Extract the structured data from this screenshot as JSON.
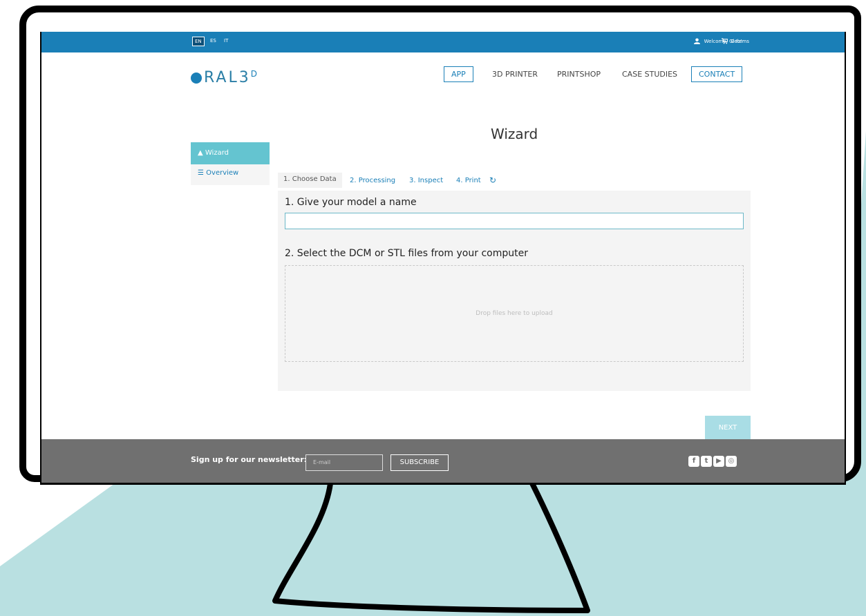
{
  "languages": [
    {
      "code": "EN",
      "active": true
    },
    {
      "code": "ES",
      "active": false
    },
    {
      "code": "IT",
      "active": false
    }
  ],
  "user": {
    "welcome": "Welcome, Gleb!"
  },
  "cart": {
    "items": "0 Items"
  },
  "brand": {
    "logo_text": "RAL3",
    "logo_suffix": "D"
  },
  "nav": [
    {
      "label": "APP",
      "boxed": true
    },
    {
      "label": "3D PRINTER",
      "boxed": false
    },
    {
      "label": "PRINTSHOP",
      "boxed": false
    },
    {
      "label": "CASE STUDIES",
      "boxed": false
    },
    {
      "label": "CONTACT",
      "boxed": true
    }
  ],
  "page": {
    "title": "Wizard"
  },
  "sidebar": {
    "items": [
      {
        "label": "Wizard",
        "active": true,
        "icon": "road-icon"
      },
      {
        "label": "Overview",
        "active": false,
        "icon": "list-icon"
      }
    ]
  },
  "tabs": [
    {
      "label": "1. Choose Data",
      "active": true
    },
    {
      "label": "2. Processing",
      "active": false
    },
    {
      "label": "3. Inspect",
      "active": false
    },
    {
      "label": "4. Print",
      "active": false
    }
  ],
  "form": {
    "step1_label": "1. Give your model a name",
    "name_value": "",
    "step2_label": "2. Select the DCM or STL files from your computer",
    "dropzone_text": "Drop files here to upload"
  },
  "buttons": {
    "next": "NEXT"
  },
  "footer": {
    "newsletter_label": "Sign up for our newsletter:",
    "email_placeholder": "E-mail",
    "subscribe": "SUBSCRIBE",
    "social": [
      "facebook-icon",
      "twitter-icon",
      "youtube-icon",
      "instagram-icon"
    ]
  },
  "colors": {
    "topbar": "#1a7fb7",
    "accent": "#64c4d0",
    "footer": "#707070",
    "background_shape": "#b9e0e1"
  }
}
